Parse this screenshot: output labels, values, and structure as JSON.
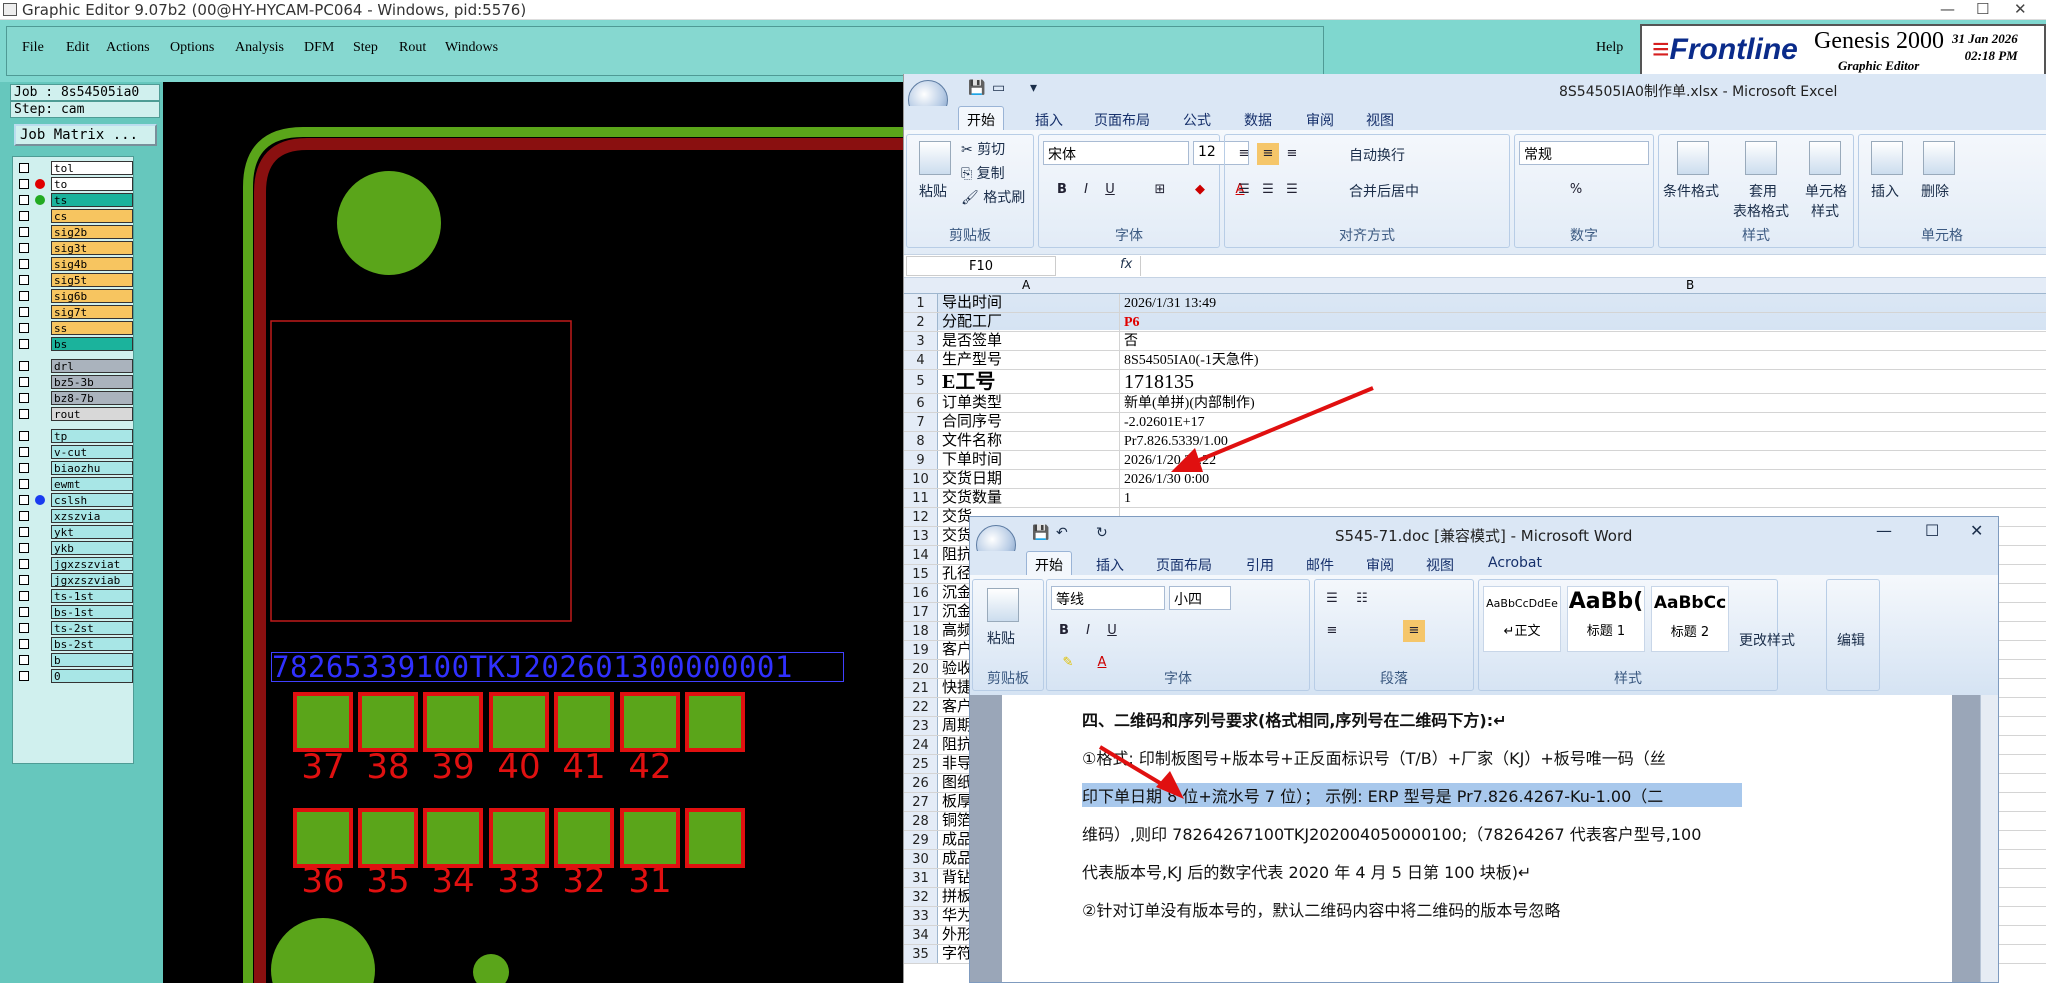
{
  "genesis": {
    "title": "Graphic Editor 9.07b2 (00@HY-HYCAM-PC064 - Windows, pid:5576)",
    "menu": [
      "File",
      "Edit",
      "Actions",
      "Options",
      "Analysis",
      "DFM",
      "Step",
      "Rout",
      "Windows"
    ],
    "help": "Help",
    "logo": {
      "brand": "Frontline",
      "product": "Genesis 2000",
      "sub": "Graphic Editor",
      "date": "31 Jan 2026",
      "time": "02:18 PM"
    },
    "job": "Job : 8s54505ia0",
    "step": "Step: cam",
    "job_matrix": "Job Matrix ...",
    "layers": [
      {
        "name": "tol",
        "color": "#ffffff",
        "dot": ""
      },
      {
        "name": "to",
        "color": "#ffffff",
        "dot": "#e00000"
      },
      {
        "name": "ts",
        "color": "#1bb39c",
        "dot": "#22aa22"
      },
      {
        "name": "cs",
        "color": "#f7c560",
        "dot": ""
      },
      {
        "name": "sig2b",
        "color": "#f7c560",
        "dot": ""
      },
      {
        "name": "sig3t",
        "color": "#f7c560",
        "dot": ""
      },
      {
        "name": "sig4b",
        "color": "#f7c560",
        "dot": ""
      },
      {
        "name": "sig5t",
        "color": "#f7c560",
        "dot": ""
      },
      {
        "name": "sig6b",
        "color": "#f7c560",
        "dot": ""
      },
      {
        "name": "sig7t",
        "color": "#f7c560",
        "dot": ""
      },
      {
        "name": "ss",
        "color": "#f7c560",
        "dot": ""
      },
      {
        "name": "bs",
        "color": "#1bb39c",
        "dot": ""
      },
      {
        "name": "drl",
        "color": "#aab3bd",
        "dot": ""
      },
      {
        "name": "bz5-3b",
        "color": "#aab3bd",
        "dot": ""
      },
      {
        "name": "bz8-7b",
        "color": "#aab3bd",
        "dot": ""
      },
      {
        "name": "rout",
        "color": "#d8d8d8",
        "dot": ""
      },
      {
        "name": "tp",
        "color": "#a8e6e6",
        "dot": ""
      },
      {
        "name": "v-cut",
        "color": "#a8e6e6",
        "dot": ""
      },
      {
        "name": "biaozhu",
        "color": "#a8e6e6",
        "dot": ""
      },
      {
        "name": "ewmt",
        "color": "#a8e6e6",
        "dot": ""
      },
      {
        "name": "cslsh",
        "color": "#a8e6e6",
        "dot": "#1a3cf0"
      },
      {
        "name": "xzszvia",
        "color": "#a8e6e6",
        "dot": ""
      },
      {
        "name": "ykt",
        "color": "#a8e6e6",
        "dot": ""
      },
      {
        "name": "ykb",
        "color": "#a8e6e6",
        "dot": ""
      },
      {
        "name": "jgxzszviat",
        "color": "#a8e6e6",
        "dot": ""
      },
      {
        "name": "jgxzszviab",
        "color": "#a8e6e6",
        "dot": ""
      },
      {
        "name": "ts-1st",
        "color": "#a8e6e6",
        "dot": ""
      },
      {
        "name": "bs-1st",
        "color": "#a8e6e6",
        "dot": ""
      },
      {
        "name": "ts-2st",
        "color": "#a8e6e6",
        "dot": ""
      },
      {
        "name": "bs-2st",
        "color": "#a8e6e6",
        "dot": ""
      },
      {
        "name": "b",
        "color": "#a8e6e6",
        "dot": ""
      },
      {
        "name": "0",
        "color": "#a8e6e6",
        "dot": ""
      }
    ],
    "serial_text": "78265339100TKJ202601300000001",
    "pads_row1": [
      "37",
      "38",
      "39",
      "40",
      "41",
      "42"
    ],
    "pads_row2": [
      "36",
      "35",
      "34",
      "33",
      "32",
      "31"
    ]
  },
  "excel": {
    "title": "8S54505IA0制作单.xlsx - Microsoft Excel",
    "tabs": [
      "开始",
      "插入",
      "页面布局",
      "公式",
      "数据",
      "审阅",
      "视图"
    ],
    "clipboard": {
      "paste": "粘贴",
      "cut": "剪切",
      "copy": "复制",
      "format_painter": "格式刷",
      "label": "剪贴板"
    },
    "font": {
      "name": "宋体",
      "size": "12",
      "label": "字体"
    },
    "align": {
      "wrap": "自动换行",
      "merge": "合并后居中",
      "label": "对齐方式"
    },
    "number": {
      "format": "常规",
      "label": "数字"
    },
    "styles": {
      "cond": "条件格式",
      "table": "套用",
      "table2": "表格格式",
      "cell": "单元格",
      "cell2": "样式",
      "label": "样式"
    },
    "cells_grp": {
      "insert": "插入",
      "delete": "删除",
      "label": "单元格"
    },
    "name_box": "F10",
    "fx": "fx",
    "col_a": "A",
    "col_b": "B",
    "rows": [
      {
        "n": "1",
        "a": "导出时间",
        "b": "2026/1/31 13:49"
      },
      {
        "n": "2",
        "a": "分配工厂",
        "b": "P6",
        "red": true
      },
      {
        "n": "3",
        "a": "是否签单",
        "b": "否"
      },
      {
        "n": "4",
        "a": "生产型号",
        "b": "8S54505IA0(-1天急件)"
      },
      {
        "n": "5",
        "a": "E工号",
        "b": "1718135",
        "big": true
      },
      {
        "n": "6",
        "a": "订单类型",
        "b": "新单(单拼)(内部制作)"
      },
      {
        "n": "7",
        "a": "合同序号",
        "b": "-2.02601E+17"
      },
      {
        "n": "8",
        "a": "文件名称",
        "b": "Pr7.826.5339/1.00"
      },
      {
        "n": "9",
        "a": "下单时间",
        "b": "2026/1/20 21:22"
      },
      {
        "n": "10",
        "a": "交货日期",
        "b": "2026/1/30 0:00"
      },
      {
        "n": "11",
        "a": "交货数量",
        "b": "1"
      },
      {
        "n": "12",
        "a": "交货",
        "b": ""
      },
      {
        "n": "13",
        "a": "交货",
        "b": ""
      },
      {
        "n": "14",
        "a": "阻抗",
        "b": ""
      },
      {
        "n": "15",
        "a": "孔径",
        "b": ""
      },
      {
        "n": "16",
        "a": "沉金",
        "b": ""
      },
      {
        "n": "17",
        "a": "沉金",
        "b": ""
      },
      {
        "n": "18",
        "a": "高频",
        "b": ""
      },
      {
        "n": "19",
        "a": "客户",
        "b": ""
      },
      {
        "n": "20",
        "a": "验收",
        "b": ""
      },
      {
        "n": "21",
        "a": "快捷",
        "b": ""
      },
      {
        "n": "22",
        "a": "客户",
        "b": ""
      },
      {
        "n": "23",
        "a": "周期",
        "b": ""
      },
      {
        "n": "24",
        "a": "阻抗",
        "b": ""
      },
      {
        "n": "25",
        "a": "非导",
        "b": ""
      },
      {
        "n": "26",
        "a": "图纸",
        "b": ""
      },
      {
        "n": "27",
        "a": "板厚",
        "b": ""
      },
      {
        "n": "28",
        "a": "铜箔",
        "b": ""
      },
      {
        "n": "29",
        "a": "成品",
        "b": ""
      },
      {
        "n": "30",
        "a": "成品",
        "b": ""
      },
      {
        "n": "31",
        "a": "背钻",
        "b": ""
      },
      {
        "n": "32",
        "a": "拼板",
        "b": ""
      },
      {
        "n": "33",
        "a": "华为",
        "b": ""
      },
      {
        "n": "34",
        "a": "外形",
        "b": ""
      },
      {
        "n": "35",
        "a": "字符",
        "b": ""
      }
    ]
  },
  "word": {
    "title": "S545-71.doc [兼容模式] - Microsoft Word",
    "tabs": [
      "开始",
      "插入",
      "页面布局",
      "引用",
      "邮件",
      "审阅",
      "视图",
      "Acrobat"
    ],
    "clipboard": {
      "paste": "粘贴",
      "label": "剪贴板"
    },
    "font": {
      "name": "等线",
      "size": "小四",
      "label": "字体"
    },
    "para_label": "段落",
    "styles": [
      {
        "preview": "AaBbCcDdEe",
        "name": "↵正文"
      },
      {
        "preview": "AaBb(",
        "name": "标题 1"
      },
      {
        "preview": "AaBbCc",
        "name": "标题 2"
      }
    ],
    "styles_label": "样式",
    "change_styles": "更改样式",
    "edit": "编辑",
    "lines": [
      "四、二维码和序列号要求(格式相同,序列号在二维码下方):↵",
      "①格式: 印制板图号+版本号+正反面标识号（T/B）+厂家（KJ）+板号唯一码（丝",
      "印下单日期 8 位+流水号 7 位）；  示例:    ERP 型号是 Pr7.826.4267-Ku-1.00（二",
      "维码）,则印  78264267100TKJ202004050000100;（78264267 代表客户型号,100",
      "代表版本号,KJ 后的数字代表 2020 年 4 月 5 日第 100 块板)↵",
      "②针对订单没有版本号的，默认二维码内容中将二维码的版本号忽略"
    ]
  }
}
